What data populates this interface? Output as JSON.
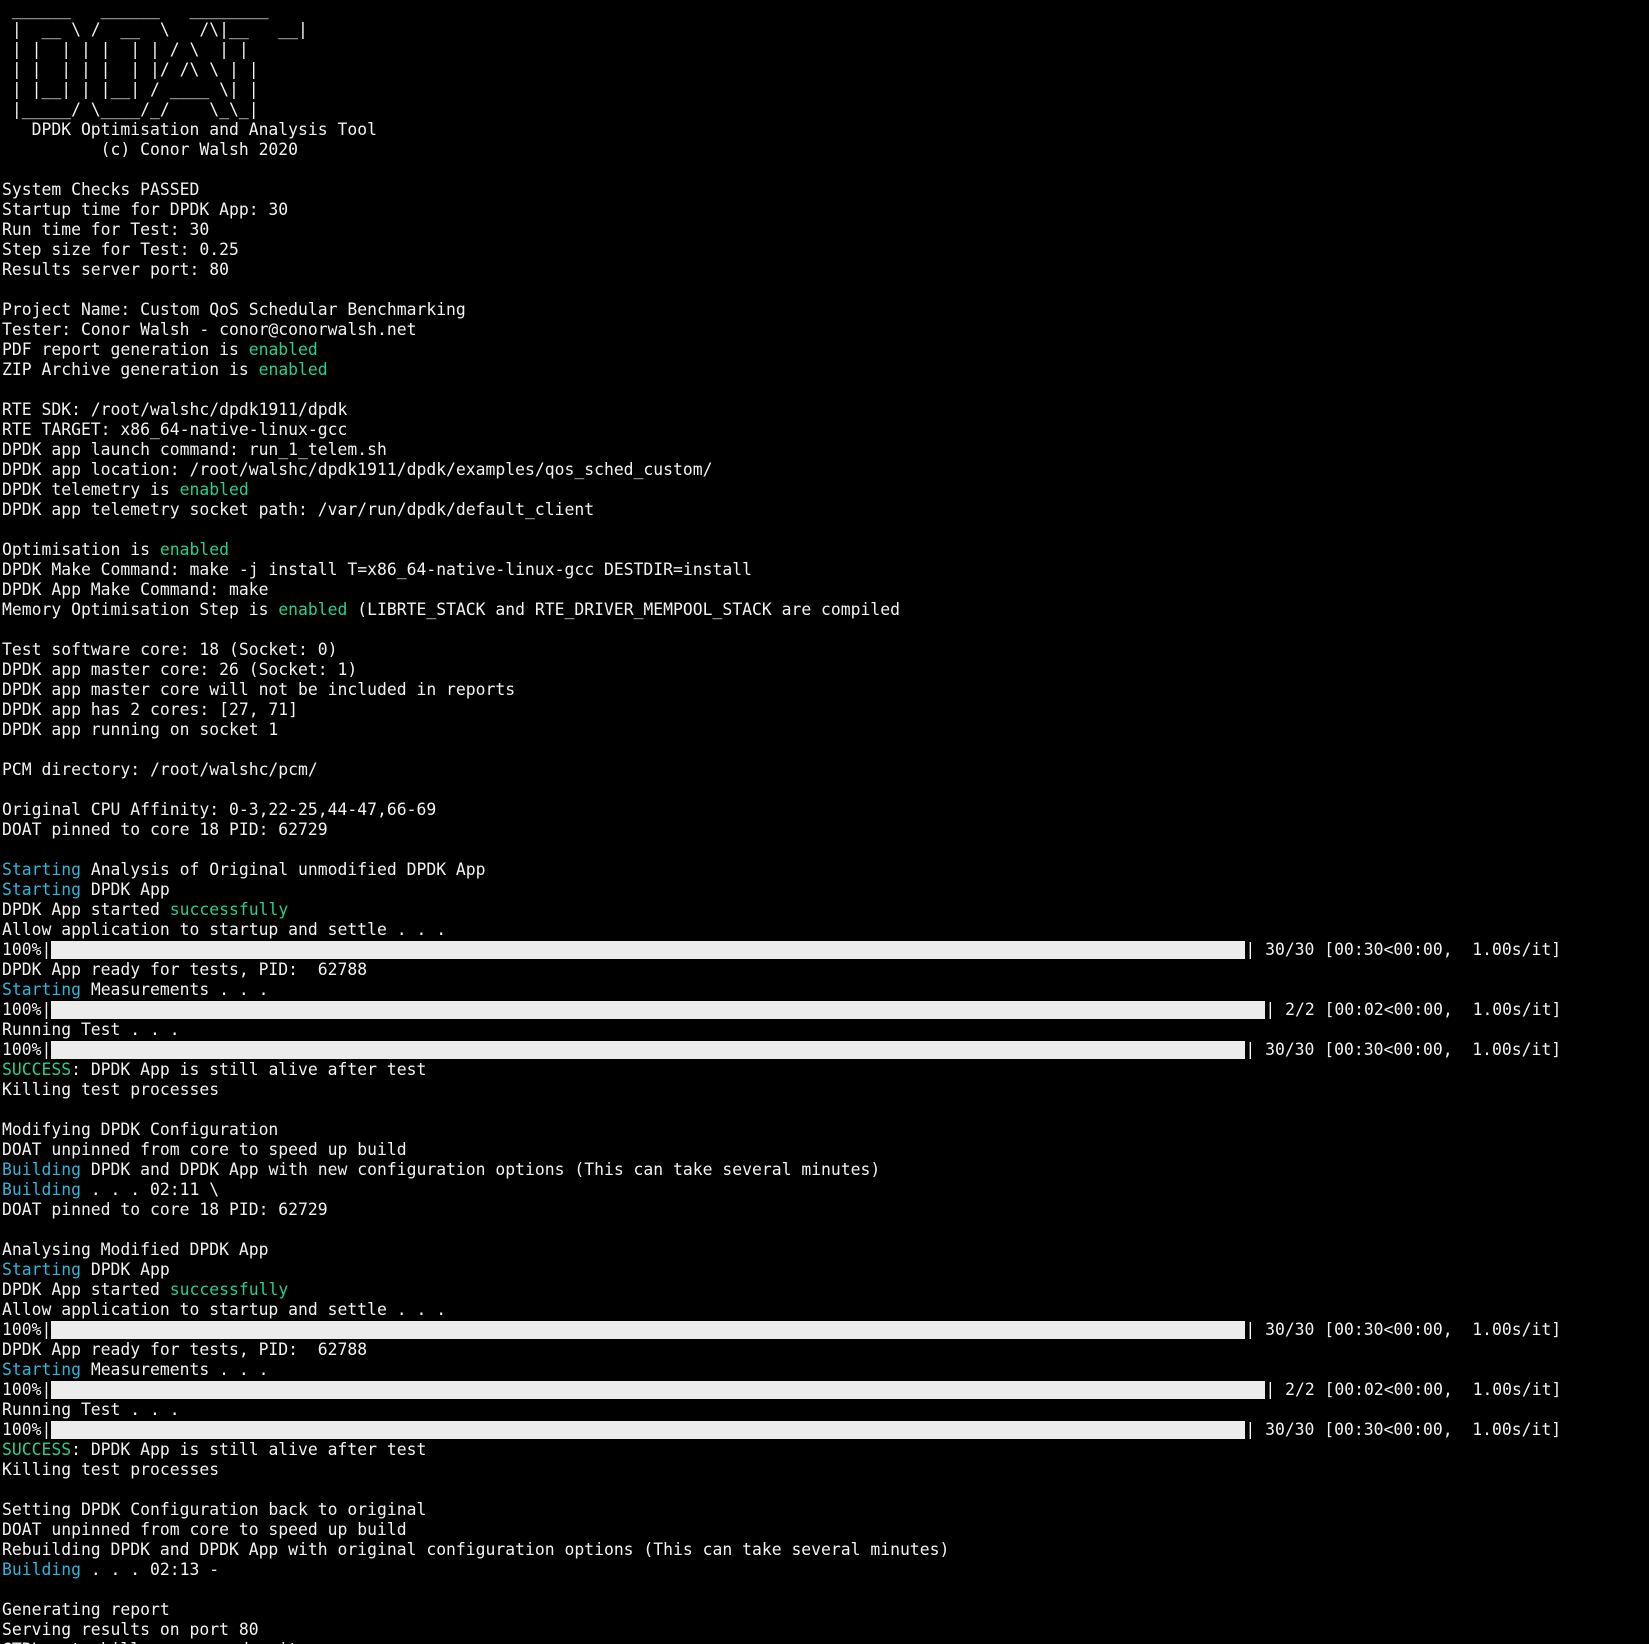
{
  "banner": {
    "ascii": " ______   ______   ________\n |  __ \\ /  __  \\   /\\|__   __|\n | |  | | |  | | / \\  | |\n | |  | | |  | |/ /\\ \\ | |\n | |__| | |__| / ____ \\| |\n |_____/ \\____/_/    \\_\\_|",
    "tool_name": "   DPDK Optimisation and Analysis Tool",
    "copyright": "          (c) Conor Walsh 2020"
  },
  "colors": {
    "background": "#000000",
    "text": "#f2f2f2",
    "green": "#23d18b",
    "cyan": "#29b8db",
    "bar": "#ececec"
  },
  "lines": [
    {
      "segs": []
    },
    {
      "segs": [
        {
          "t": "System Checks PASSED"
        }
      ]
    },
    {
      "segs": [
        {
          "t": "Startup time for DPDK App: 30"
        }
      ]
    },
    {
      "segs": [
        {
          "t": "Run time for Test: 30"
        }
      ]
    },
    {
      "segs": [
        {
          "t": "Step size for Test: 0.25"
        }
      ]
    },
    {
      "segs": [
        {
          "t": "Results server port: 80"
        }
      ]
    },
    {
      "segs": []
    },
    {
      "segs": [
        {
          "t": "Project Name: Custom QoS Schedular Benchmarking"
        }
      ]
    },
    {
      "segs": [
        {
          "t": "Tester: Conor Walsh - conor@conorwalsh.net"
        }
      ]
    },
    {
      "segs": [
        {
          "t": "PDF report generation is "
        },
        {
          "t": "enabled",
          "c": "green"
        }
      ]
    },
    {
      "segs": [
        {
          "t": "ZIP Archive generation is "
        },
        {
          "t": "enabled",
          "c": "green"
        }
      ]
    },
    {
      "segs": []
    },
    {
      "segs": [
        {
          "t": "RTE SDK: /root/walshc/dpdk1911/dpdk"
        }
      ]
    },
    {
      "segs": [
        {
          "t": "RTE TARGET: x86_64-native-linux-gcc"
        }
      ]
    },
    {
      "segs": [
        {
          "t": "DPDK app launch command: run_1_telem.sh"
        }
      ]
    },
    {
      "segs": [
        {
          "t": "DPDK app location: /root/walshc/dpdk1911/dpdk/examples/qos_sched_custom/"
        }
      ]
    },
    {
      "segs": [
        {
          "t": "DPDK telemetry is "
        },
        {
          "t": "enabled",
          "c": "green"
        }
      ]
    },
    {
      "segs": [
        {
          "t": "DPDK app telemetry socket path: /var/run/dpdk/default_client"
        }
      ]
    },
    {
      "segs": []
    },
    {
      "segs": [
        {
          "t": "Optimisation is "
        },
        {
          "t": "enabled",
          "c": "green"
        }
      ]
    },
    {
      "segs": [
        {
          "t": "DPDK Make Command: make -j install T=x86_64-native-linux-gcc DESTDIR=install"
        }
      ]
    },
    {
      "segs": [
        {
          "t": "DPDK App Make Command: make"
        }
      ]
    },
    {
      "segs": [
        {
          "t": "Memory Optimisation Step is "
        },
        {
          "t": "enabled",
          "c": "green"
        },
        {
          "t": " (LIBRTE_STACK and RTE_DRIVER_MEMPOOL_STACK are compiled"
        }
      ]
    },
    {
      "segs": []
    },
    {
      "segs": [
        {
          "t": "Test software core: 18 (Socket: 0)"
        }
      ]
    },
    {
      "segs": [
        {
          "t": "DPDK app master core: 26 (Socket: 1)"
        }
      ]
    },
    {
      "segs": [
        {
          "t": "DPDK app master core will not be included in reports"
        }
      ]
    },
    {
      "segs": [
        {
          "t": "DPDK app has 2 cores: [27, 71]"
        }
      ]
    },
    {
      "segs": [
        {
          "t": "DPDK app running on socket 1"
        }
      ]
    },
    {
      "segs": []
    },
    {
      "segs": [
        {
          "t": "PCM directory: /root/walshc/pcm/"
        }
      ]
    },
    {
      "segs": []
    },
    {
      "segs": [
        {
          "t": "Original CPU Affinity: 0-3,22-25,44-47,66-69"
        }
      ]
    },
    {
      "segs": [
        {
          "t": "DOAT pinned to core 18 PID: 62729"
        }
      ]
    },
    {
      "segs": []
    },
    {
      "segs": [
        {
          "t": "Starting",
          "c": "cyan"
        },
        {
          "t": " Analysis of Original unmodified DPDK App"
        }
      ]
    },
    {
      "segs": [
        {
          "t": "Starting",
          "c": "cyan"
        },
        {
          "t": " DPDK App"
        }
      ]
    },
    {
      "segs": [
        {
          "t": "DPDK App started "
        },
        {
          "t": "successfully",
          "c": "green"
        }
      ]
    },
    {
      "segs": [
        {
          "t": "Allow application to startup and settle . . ."
        }
      ]
    },
    {
      "progress": {
        "pct": "100%|",
        "fraction": 1.0,
        "tail": "| 30/30 [00:30<00:00,  1.00s/it]"
      }
    },
    {
      "segs": [
        {
          "t": "DPDK App ready for tests, PID:  62788"
        }
      ]
    },
    {
      "segs": [
        {
          "t": "Starting",
          "c": "cyan"
        },
        {
          "t": " Measurements . . ."
        }
      ]
    },
    {
      "progress": {
        "pct": "100%|",
        "fraction": 1.0,
        "tail": "| 2/2 [00:02<00:00,  1.00s/it]"
      }
    },
    {
      "segs": [
        {
          "t": "Running Test . . ."
        }
      ]
    },
    {
      "progress": {
        "pct": "100%|",
        "fraction": 1.0,
        "tail": "| 30/30 [00:30<00:00,  1.00s/it]"
      }
    },
    {
      "segs": [
        {
          "t": "SUCCESS",
          "c": "green"
        },
        {
          "t": ": DPDK App is still alive after test"
        }
      ]
    },
    {
      "segs": [
        {
          "t": "Killing test processes"
        }
      ]
    },
    {
      "segs": []
    },
    {
      "segs": [
        {
          "t": "Modifying DPDK Configuration"
        }
      ]
    },
    {
      "segs": [
        {
          "t": "DOAT unpinned from core to speed up build"
        }
      ]
    },
    {
      "segs": [
        {
          "t": "Building",
          "c": "cyan"
        },
        {
          "t": " DPDK and DPDK App with new configuration options (This can take several minutes)"
        }
      ]
    },
    {
      "segs": [
        {
          "t": "Building",
          "c": "cyan"
        },
        {
          "t": " . . . 02:11 \\"
        }
      ]
    },
    {
      "segs": [
        {
          "t": "DOAT pinned to core 18 PID: 62729"
        }
      ]
    },
    {
      "segs": []
    },
    {
      "segs": [
        {
          "t": "Analysing Modified DPDK App"
        }
      ]
    },
    {
      "segs": [
        {
          "t": "Starting",
          "c": "cyan"
        },
        {
          "t": " DPDK App"
        }
      ]
    },
    {
      "segs": [
        {
          "t": "DPDK App started "
        },
        {
          "t": "successfully",
          "c": "green"
        }
      ]
    },
    {
      "segs": [
        {
          "t": "Allow application to startup and settle . . ."
        }
      ]
    },
    {
      "progress": {
        "pct": "100%|",
        "fraction": 1.0,
        "tail": "| 30/30 [00:30<00:00,  1.00s/it]"
      }
    },
    {
      "segs": [
        {
          "t": "DPDK App ready for tests, PID:  62788"
        }
      ]
    },
    {
      "segs": [
        {
          "t": "Starting",
          "c": "cyan"
        },
        {
          "t": " Measurements . . ."
        }
      ]
    },
    {
      "progress": {
        "pct": "100%|",
        "fraction": 1.0,
        "tail": "| 2/2 [00:02<00:00,  1.00s/it]"
      }
    },
    {
      "segs": [
        {
          "t": "Running Test . . ."
        }
      ]
    },
    {
      "progress": {
        "pct": "100%|",
        "fraction": 1.0,
        "tail": "| 30/30 [00:30<00:00,  1.00s/it]"
      }
    },
    {
      "segs": [
        {
          "t": "SUCCESS",
          "c": "green"
        },
        {
          "t": ": DPDK App is still alive after test"
        }
      ]
    },
    {
      "segs": [
        {
          "t": "Killing test processes"
        }
      ]
    },
    {
      "segs": []
    },
    {
      "segs": [
        {
          "t": "Setting DPDK Configuration back to original"
        }
      ]
    },
    {
      "segs": [
        {
          "t": "DOAT unpinned from core to speed up build"
        }
      ]
    },
    {
      "segs": [
        {
          "t": "Rebuilding DPDK and DPDK App with original configuration options (This can take several minutes)"
        }
      ]
    },
    {
      "segs": [
        {
          "t": "Building",
          "c": "cyan"
        },
        {
          "t": " . . . 02:13 -"
        }
      ]
    },
    {
      "segs": []
    },
    {
      "segs": [
        {
          "t": "Generating report"
        }
      ]
    },
    {
      "segs": [
        {
          "t": "Serving results on port 80"
        }
      ]
    },
    {
      "segs": [
        {
          "t": "CTRL+c to kill server and exit"
        }
      ]
    }
  ]
}
